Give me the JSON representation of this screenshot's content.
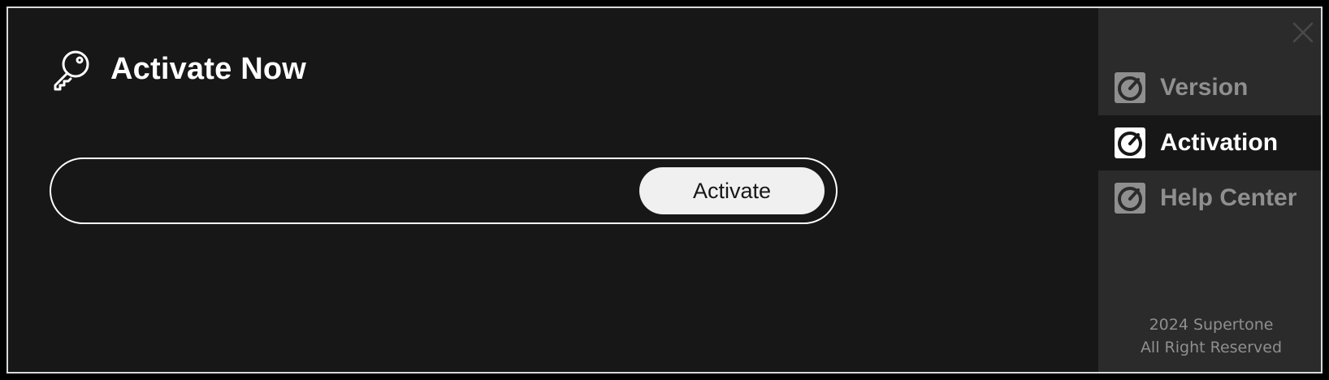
{
  "header": {
    "title": "Activate Now",
    "icon": "key-icon"
  },
  "activation": {
    "code_value": "",
    "code_placeholder": "",
    "button_label": "Activate"
  },
  "sidebar": {
    "close_icon": "close-icon",
    "items": [
      {
        "label": "Version",
        "icon": "dial-icon",
        "active": false
      },
      {
        "label": "Activation",
        "icon": "dial-icon",
        "active": true
      },
      {
        "label": "Help Center",
        "icon": "dial-icon",
        "active": false
      }
    ],
    "footer_line1": "2024 Supertone",
    "footer_line2": "All Right Reserved"
  },
  "colors": {
    "background": "#171717",
    "sidebar": "#2b2b2b",
    "accent": "#ffffff",
    "muted_text": "#8f8f8f",
    "button_bg": "#f0f0f0"
  }
}
